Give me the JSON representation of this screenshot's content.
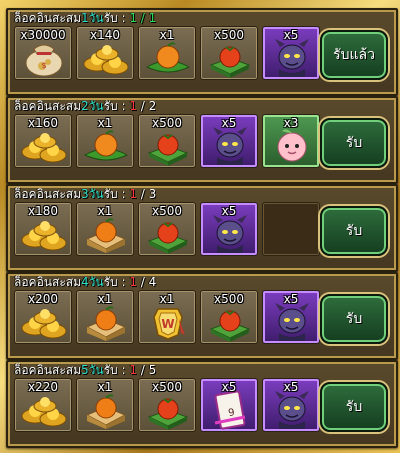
{
  "rows": [
    {
      "title_prefix": "ล็อคอินสะสม",
      "day_text": "1วัน",
      "title_suffix": "รับ : ",
      "progress_current": "1",
      "progress_sep": " / ",
      "progress_total": "1",
      "completed": true,
      "button_label": "รับแล้ว",
      "items": [
        {
          "qty": "x30000",
          "icon": "coin-sack"
        },
        {
          "qty": "x140",
          "icon": "gold-ingots"
        },
        {
          "qty": "x1",
          "icon": "peach-on-leaf"
        },
        {
          "qty": "x500",
          "icon": "fruit-on-tray"
        },
        {
          "qty": "x5",
          "icon": "demon-card"
        }
      ]
    },
    {
      "title_prefix": "ล็อคอินสะสม",
      "day_text": "2วัน",
      "title_suffix": "รับ : ",
      "progress_current": "1",
      "progress_sep": " / ",
      "progress_total": "2",
      "completed": false,
      "button_label": "รับ",
      "items": [
        {
          "qty": "x160",
          "icon": "gold-ingots"
        },
        {
          "qty": "x1",
          "icon": "peach-on-leaf"
        },
        {
          "qty": "x500",
          "icon": "fruit-on-tray"
        },
        {
          "qty": "x5",
          "icon": "demon-card"
        },
        {
          "qty": "x3",
          "icon": "peach-creature"
        }
      ]
    },
    {
      "title_prefix": "ล็อคอินสะสม",
      "day_text": "3วัน",
      "title_suffix": "รับ : ",
      "progress_current": "1",
      "progress_sep": " / ",
      "progress_total": "3",
      "completed": false,
      "button_label": "รับ",
      "items": [
        {
          "qty": "x180",
          "icon": "gold-ingots"
        },
        {
          "qty": "x1",
          "icon": "peach-in-box"
        },
        {
          "qty": "x500",
          "icon": "fruit-on-tray"
        },
        {
          "qty": "x5",
          "icon": "demon-card"
        },
        {
          "qty": "",
          "icon": "empty"
        }
      ]
    },
    {
      "title_prefix": "ล็อคอินสะสม",
      "day_text": "4วัน",
      "title_suffix": "รับ : ",
      "progress_current": "1",
      "progress_sep": " / ",
      "progress_total": "4",
      "completed": false,
      "button_label": "รับ",
      "items": [
        {
          "qty": "x200",
          "icon": "gold-ingots"
        },
        {
          "qty": "x1",
          "icon": "peach-in-box"
        },
        {
          "qty": "x1",
          "icon": "gold-badge"
        },
        {
          "qty": "x500",
          "icon": "fruit-on-tray"
        },
        {
          "qty": "x5",
          "icon": "demon-card"
        }
      ]
    },
    {
      "title_prefix": "ล็อคอินสะสม",
      "day_text": "5วัน",
      "title_suffix": "รับ : ",
      "progress_current": "1",
      "progress_sep": " / ",
      "progress_total": "5",
      "completed": false,
      "button_label": "รับ",
      "items": [
        {
          "qty": "x220",
          "icon": "gold-ingots"
        },
        {
          "qty": "x1",
          "icon": "peach-in-box"
        },
        {
          "qty": "x500",
          "icon": "fruit-on-tray"
        },
        {
          "qty": "x5",
          "icon": "scroll-card"
        },
        {
          "qty": "x5",
          "icon": "demon-card"
        }
      ]
    }
  ]
}
